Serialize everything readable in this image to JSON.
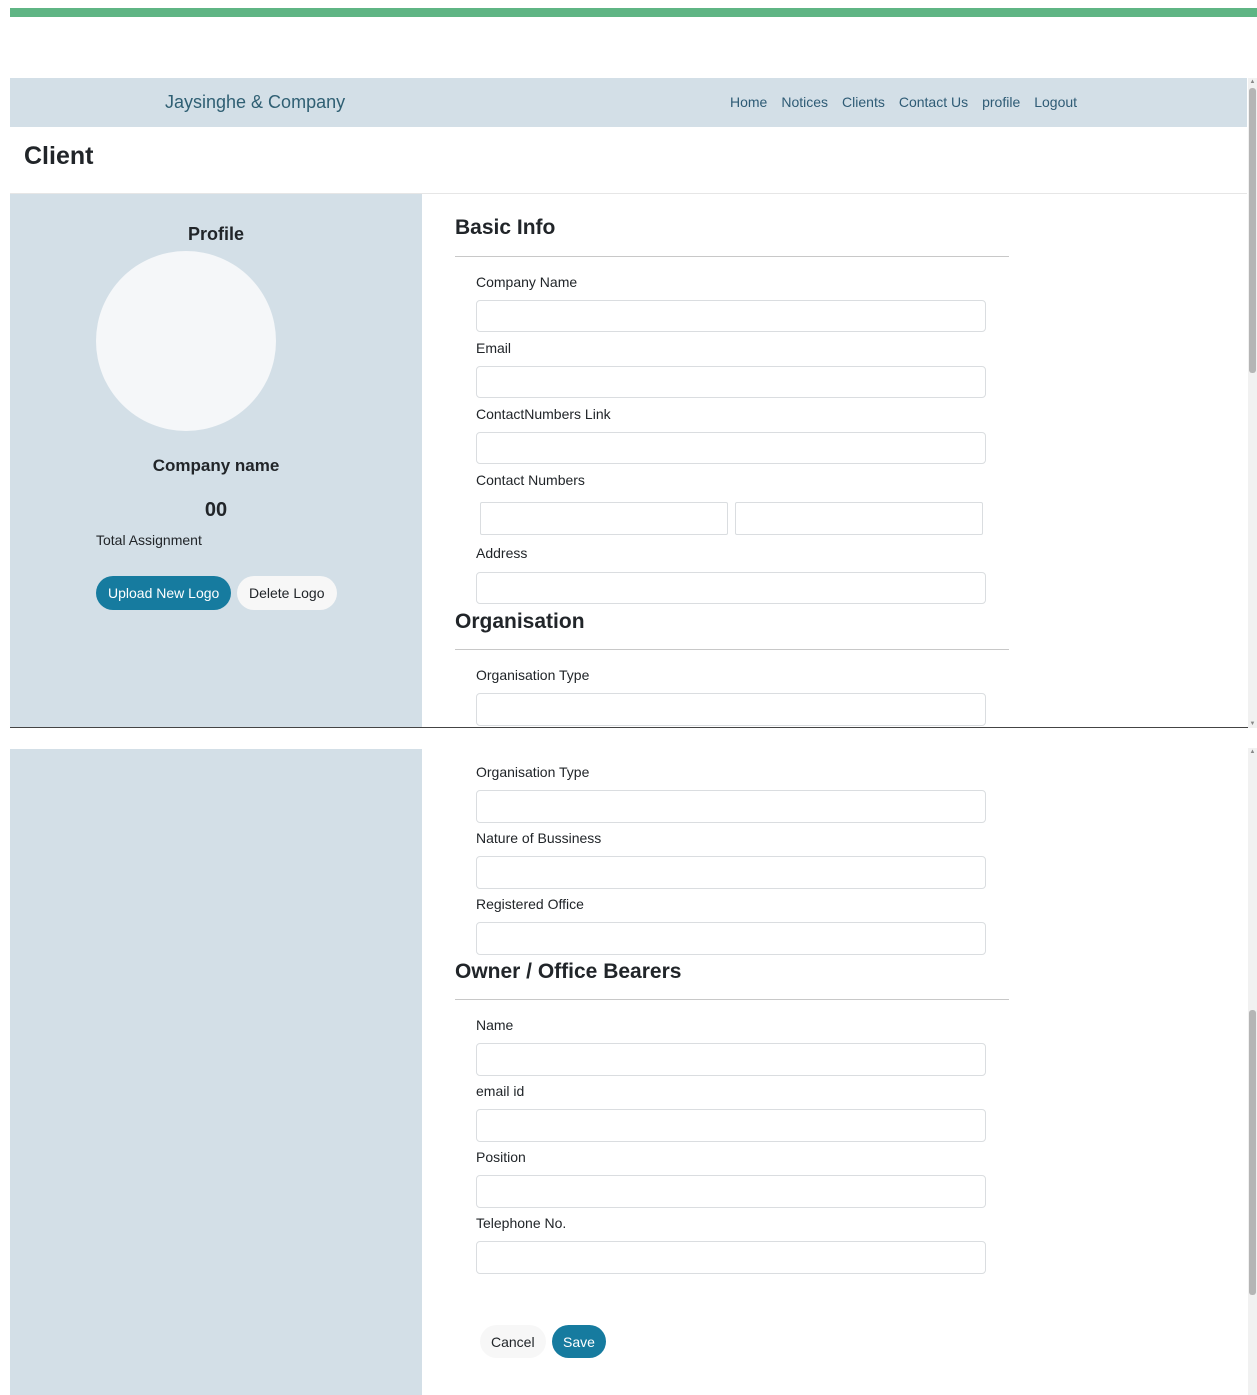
{
  "brand": "Jaysinghe & Company",
  "nav": [
    "Home",
    "Notices",
    "Clients",
    "Contact Us",
    "profile",
    "Logout"
  ],
  "page_title": "Client",
  "profile": {
    "heading": "Profile",
    "company_name": "Company name",
    "total_count": "00",
    "total_label": "Total Assignment",
    "upload_label": "Upload New Logo",
    "delete_label": "Delete Logo"
  },
  "sections": {
    "basic_info": "Basic Info",
    "organisation": "Organisation",
    "owner": "Owner / Office Bearers"
  },
  "fields": {
    "company_name": "Company Name",
    "email": "Email",
    "contact_link": "ContactNumbers Link",
    "contact_numbers": "Contact Numbers",
    "address": "Address",
    "organisation_type": "Organisation Type",
    "nature_of_business": "Nature of Bussiness",
    "registered_office": "Registered Office",
    "name": "Name",
    "email_id": "email id",
    "position": "Position",
    "telephone": "Telephone No."
  },
  "actions": {
    "cancel": "Cancel",
    "save": "Save"
  },
  "colors": {
    "accent_bar": "#5fb584",
    "panel": "#d3dfe7",
    "primary_button": "#167b9f"
  }
}
